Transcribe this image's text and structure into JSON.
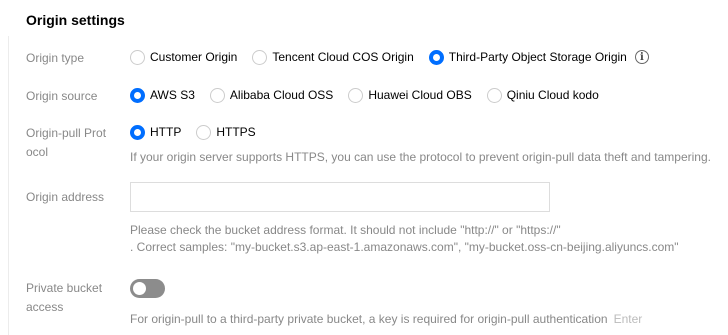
{
  "section": {
    "title": "Origin settings"
  },
  "origin_type": {
    "label": "Origin type",
    "options": [
      "Customer Origin",
      "Tencent Cloud COS Origin",
      "Third-Party Object Storage Origin"
    ],
    "selected": "Third-Party Object Storage Origin",
    "info_icon_glyph": "i"
  },
  "origin_source": {
    "label": "Origin source",
    "options": [
      "AWS S3",
      "Alibaba Cloud OSS",
      "Huawei Cloud OBS",
      "Qiniu Cloud kodo"
    ],
    "selected": "AWS S3"
  },
  "origin_pull_protocol": {
    "label": "Origin-pull Prot ocol",
    "options": [
      "HTTP",
      "HTTPS"
    ],
    "selected": "HTTP",
    "hint": "If your origin server supports HTTPS, you can use the protocol to prevent origin-pull data theft and tampering."
  },
  "origin_address": {
    "label": "Origin address",
    "value": "",
    "placeholder": "",
    "hint_line1": "Please check the bucket address format. It should not include \"http://\" or \"https://\"",
    "hint_line2": ". Correct samples: \"my-bucket.s3.ap-east-1.amazonaws.com\", \"my-bucket.oss-cn-beijing.aliyuncs.com\""
  },
  "private_bucket_access": {
    "label": "Private bucket access",
    "enabled": false,
    "hint": "For origin-pull to a third-party private bucket, a key is required for origin-pull authentication",
    "enter_label": "Enter"
  },
  "colors": {
    "accent": "#006eff",
    "label": "#888888",
    "toggle_off": "#8c8c8c"
  },
  "icons": {
    "info": "info-icon"
  }
}
